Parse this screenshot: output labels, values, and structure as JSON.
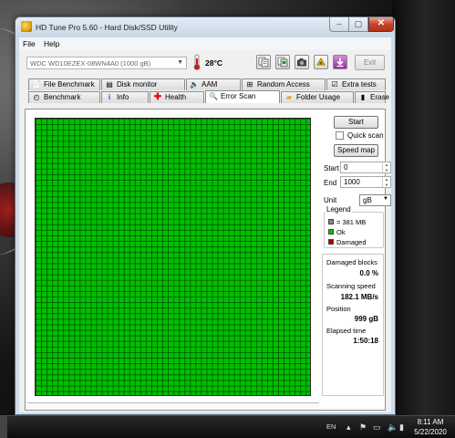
{
  "window": {
    "title": "HD Tune Pro 5.60 - Hard Disk/SSD Utility",
    "minimize": "‒",
    "maximize": "▢",
    "close": "✕"
  },
  "menu": {
    "file": "File",
    "help": "Help"
  },
  "toolbar": {
    "drive": "WDC WD10EZEX-08WN4A0 (1000 gB)",
    "temperature": "28°C",
    "exit_label": "Exit",
    "icons": [
      "copy-text-icon",
      "copy-screenshot-icon",
      "camera-icon",
      "save-icon",
      "download-icon"
    ]
  },
  "tabs": {
    "row1": [
      "File Benchmark",
      "Disk monitor",
      "AAM",
      "Random Access",
      "Extra tests"
    ],
    "row2": [
      "Benchmark",
      "Info",
      "Health",
      "Error Scan",
      "Folder Usage",
      "Erase"
    ],
    "active": "Error Scan"
  },
  "error_scan": {
    "start_label": "Start",
    "quick_scan_label": "Quick scan",
    "quick_scan_checked": false,
    "speed_map_label": "Speed map",
    "start_field_label": "Start",
    "start_value": "0",
    "end_field_label": "End",
    "end_value": "1000",
    "unit_label": "Unit",
    "unit_value": "gB",
    "legend": {
      "title": "Legend",
      "items": [
        {
          "label": "= 381 MB",
          "color": "#8a8a8a"
        },
        {
          "label": "Ok",
          "color": "#00c000"
        },
        {
          "label": "Damaged",
          "color": "#b00000"
        }
      ]
    },
    "stats": {
      "damaged_blocks_label": "Damaged blocks",
      "damaged_blocks_value": "0.0 %",
      "scanning_speed_label": "Scanning speed",
      "scanning_speed_value": "182.1 MB/s",
      "position_label": "Position",
      "position_value": "999 gB",
      "elapsed_time_label": "Elapsed time",
      "elapsed_time_value": "1:50:18"
    },
    "grid_color": "#00c000"
  },
  "taskbar": {
    "language": "EN",
    "time": "8:11 AM",
    "date": "5/22/2020"
  }
}
